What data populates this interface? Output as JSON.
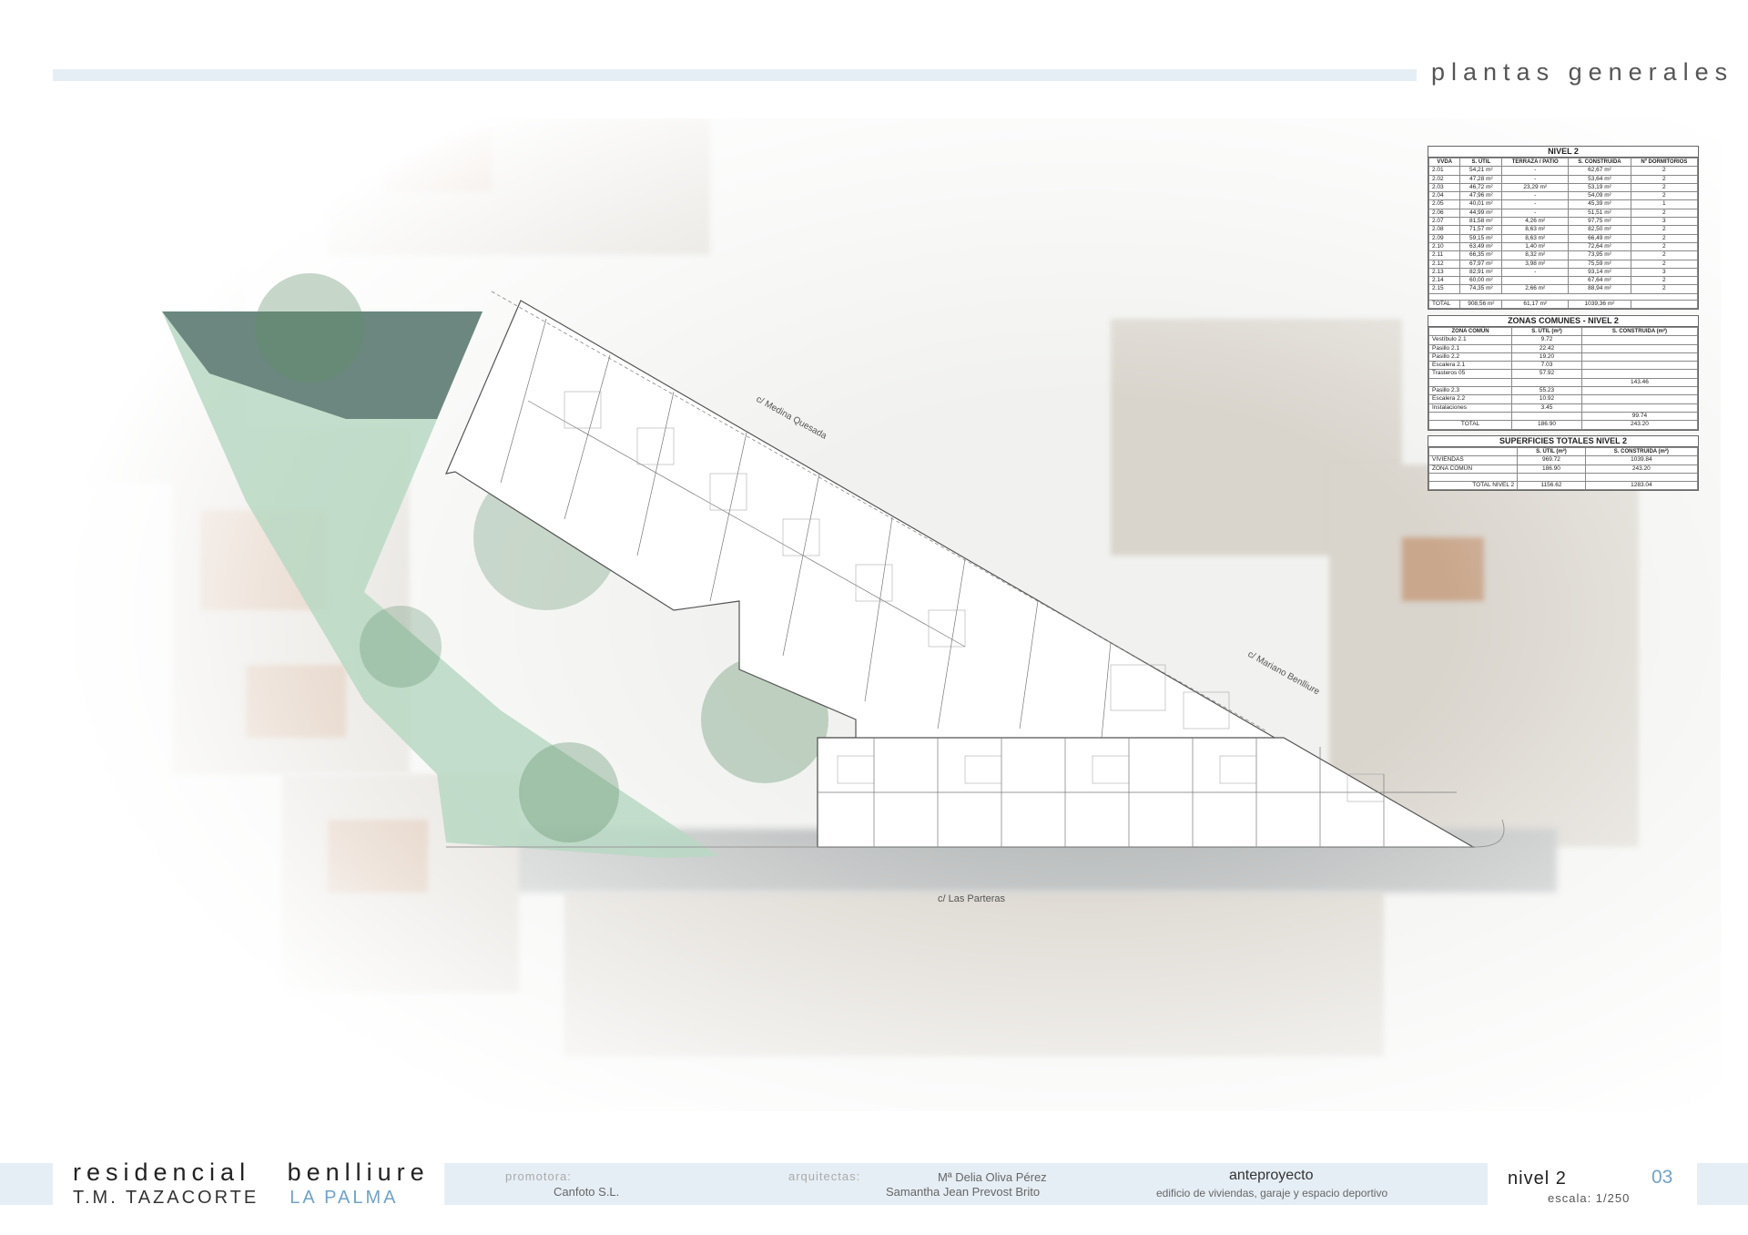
{
  "header": {
    "section": "plantas generales"
  },
  "plan": {
    "streets": {
      "medina": "c/ Medina Quesada",
      "benlliure": "c/ Mariano Benlliure",
      "parteras": "c/ Las Parteras"
    }
  },
  "table_units": {
    "caption": "NIVEL 2",
    "headers": [
      "VVDA",
      "S. ÚTIL",
      "TERRAZA / PATIO",
      "S. CONSTRUIDA",
      "Nº DORMITORIOS"
    ],
    "rows": [
      [
        "2.01",
        "54,21 m²",
        "-",
        "62,67 m²",
        "2"
      ],
      [
        "2.02",
        "47,28 m²",
        "-",
        "53,64 m²",
        "2"
      ],
      [
        "2.03",
        "46,72 m²",
        "23,29 m²",
        "53,19 m²",
        "2"
      ],
      [
        "2.04",
        "47,96 m²",
        "-",
        "54,09 m²",
        "2"
      ],
      [
        "2.05",
        "40,01 m²",
        "-",
        "45,39 m²",
        "1"
      ],
      [
        "2.06",
        "44,99 m²",
        "-",
        "51,51 m²",
        "2"
      ],
      [
        "2.07",
        "81,58 m²",
        "4,26 m²",
        "97,75 m²",
        "3"
      ],
      [
        "2.08",
        "71,57 m²",
        "8,63 m²",
        "82,50 m²",
        "2"
      ],
      [
        "2.09",
        "59,15 m²",
        "8,63 m²",
        "66,49 m²",
        "2"
      ],
      [
        "2.10",
        "63,49 m²",
        "1,40 m²",
        "72,64 m²",
        "2"
      ],
      [
        "2.11",
        "66,35 m²",
        "8,32 m²",
        "73,95 m²",
        "2"
      ],
      [
        "2.12",
        "67,97 m²",
        "3,98 m²",
        "75,59 m²",
        "2"
      ],
      [
        "2.13",
        "82,91 m²",
        "-",
        "93,14 m²",
        "3"
      ],
      [
        "2.14",
        "60,00 m²",
        "",
        "67,64 m²",
        "2"
      ],
      [
        "2.15",
        "74,35 m²",
        "2,66 m²",
        "88,94 m²",
        "2"
      ]
    ],
    "total": [
      "TOTAL",
      "908,56 m²",
      "61,17 m²",
      "1039,36 m²",
      ""
    ]
  },
  "table_common": {
    "caption": "ZONAS COMUNES - NIVEL 2",
    "headers": [
      "ZONA COMÚN",
      "S. ÚTIL (m²)",
      "S. CONSTRUIDA (m²)"
    ],
    "rows": [
      [
        "Vestíbulo 2.1",
        "9.72",
        ""
      ],
      [
        "Pasillo 2.1",
        "22.42",
        ""
      ],
      [
        "Pasillo 2.2",
        "19.20",
        ""
      ],
      [
        "Escalera 2.1",
        "7.03",
        ""
      ],
      [
        "Trasteros 05",
        "57.92",
        ""
      ],
      [
        "",
        "",
        "143.46"
      ],
      [
        "Pasillo 2.3",
        "55.23",
        ""
      ],
      [
        "Escalera 2.2",
        "10.92",
        ""
      ],
      [
        "Instalaciones",
        "3.45",
        ""
      ],
      [
        "",
        "",
        "99.74"
      ]
    ],
    "total": [
      "TOTAL",
      "186.90",
      "243.20"
    ]
  },
  "table_totals": {
    "caption": "SUPERFICIES TOTALES NIVEL 2",
    "headers": [
      "",
      "S. ÚTIL (m²)",
      "S. CONSTRUIDA (m²)"
    ],
    "rows": [
      [
        "VIVIENDAS",
        "969.72",
        "1039.84"
      ],
      [
        "ZONA COMÚN",
        "186.90",
        "243.20"
      ],
      [
        "",
        "",
        ""
      ]
    ],
    "total": [
      "TOTAL NIVEL 2",
      "1156.62",
      "1283.04"
    ]
  },
  "footer": {
    "title": "residencial   benlliure",
    "subtitle_a": "T.M. TAZACORTE",
    "subtitle_b": "LA PALMA",
    "promotora_label": "promotora:",
    "promotora": "Canfoto S.L.",
    "arquitectas_label": "arquitectas:",
    "arquitecta_1": "Mª Delia Oliva Pérez",
    "arquitecta_2": "Samantha Jean Prevost Brito",
    "phase": "anteproyecto",
    "phase_desc": "edificio de viviendas, garaje y espacio deportivo",
    "level": "nivel 2",
    "page": "03",
    "scale": "escala: 1/250"
  },
  "colors": {
    "accent": "#6fa3c9",
    "band": "#e6eef5",
    "green_space": "#b9d8c3"
  }
}
